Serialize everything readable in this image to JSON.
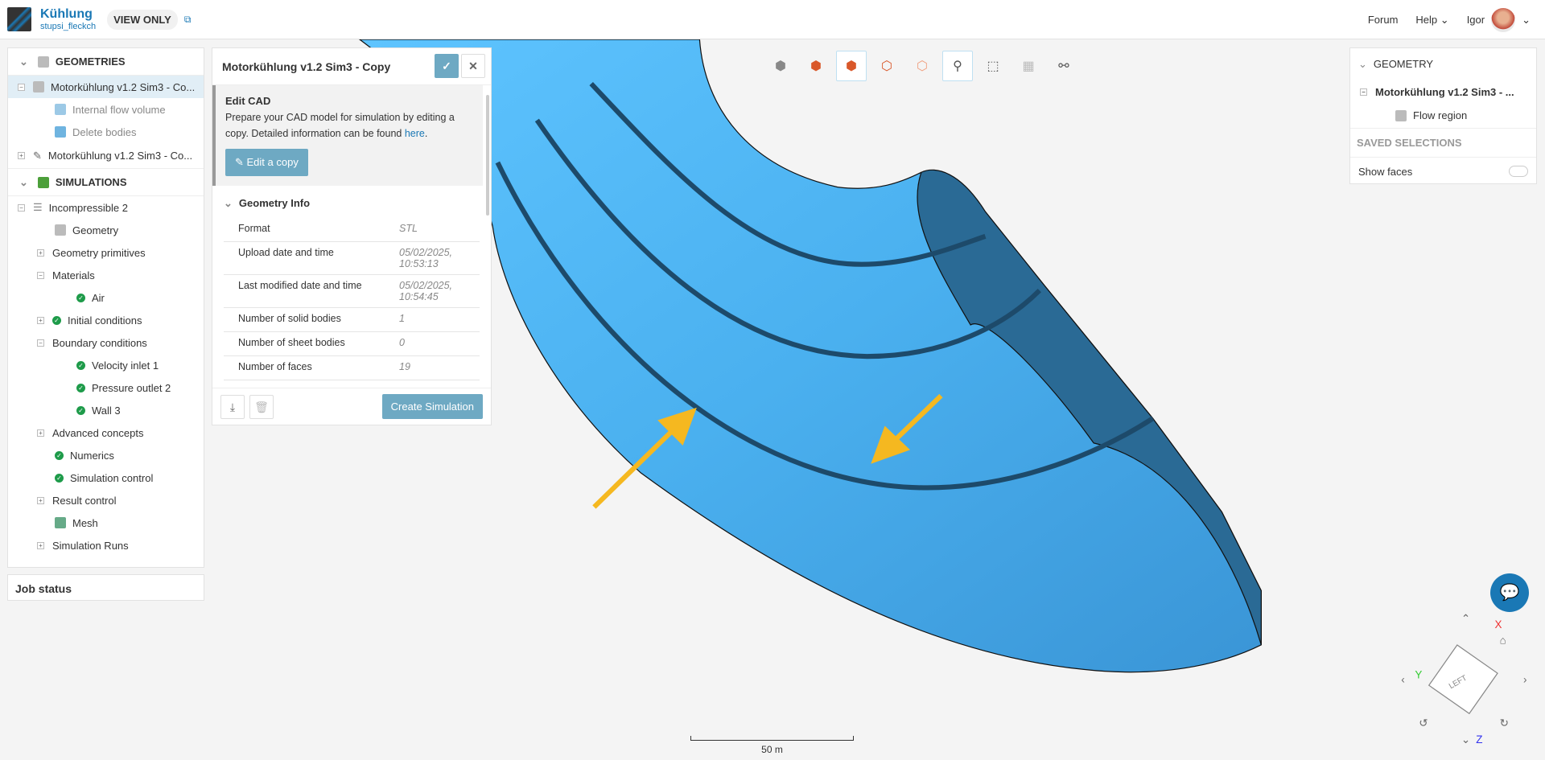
{
  "header": {
    "project": "Kühlung",
    "owner": "stupsi_fleckch",
    "badge": "VIEW ONLY",
    "forum": "Forum",
    "help": "Help",
    "user": "Igor"
  },
  "tree": {
    "geometries": "GEOMETRIES",
    "geo1": "Motorkühlung v1.2 Sim3 - Co...",
    "internal": "Internal flow volume",
    "delete": "Delete bodies",
    "geo2": "Motorkühlung v1.2 Sim3 - Co...",
    "simulations": "SIMULATIONS",
    "items": [
      "Incompressible 2",
      "Geometry",
      "Geometry primitives",
      "Materials",
      "Air",
      "Initial conditions",
      "Boundary conditions",
      "Velocity inlet 1",
      "Pressure outlet 2",
      "Wall 3",
      "Advanced concepts",
      "Numerics",
      "Simulation control",
      "Result control",
      "Mesh",
      "Simulation Runs"
    ]
  },
  "job_status": "Job status",
  "cad": {
    "title": "Motorkühlung v1.2 Sim3 - Copy",
    "edit_title": "Edit CAD",
    "edit_text": "Prepare your CAD model for simulation by editing a copy. Detailed information can be found ",
    "link": "here",
    "edit_btn": "Edit a copy",
    "info_title": "Geometry Info",
    "info": [
      {
        "k": "Format",
        "v": "STL"
      },
      {
        "k": "Upload date and time",
        "v": "05/02/2025, 10:53:13"
      },
      {
        "k": "Last modified date and time",
        "v": "05/02/2025, 10:54:45"
      },
      {
        "k": "Number of solid bodies",
        "v": "1"
      },
      {
        "k": "Number of sheet bodies",
        "v": "0"
      },
      {
        "k": "Number of faces",
        "v": "19"
      }
    ],
    "create": "Create Simulation"
  },
  "right": {
    "geometry": "GEOMETRY",
    "model": "Motorkühlung v1.2 Sim3 - ...",
    "flow": "Flow region",
    "saved": "SAVED SELECTIONS",
    "show_faces": "Show faces"
  },
  "scale": "50 m",
  "axes": {
    "x": "X",
    "y": "Y",
    "z": "Z",
    "face": "LEFT"
  },
  "colors": {
    "body": "#3d9fe0",
    "cut": "#2a6a95",
    "accent": "#1a78b5",
    "arrow": "#f5b820"
  }
}
